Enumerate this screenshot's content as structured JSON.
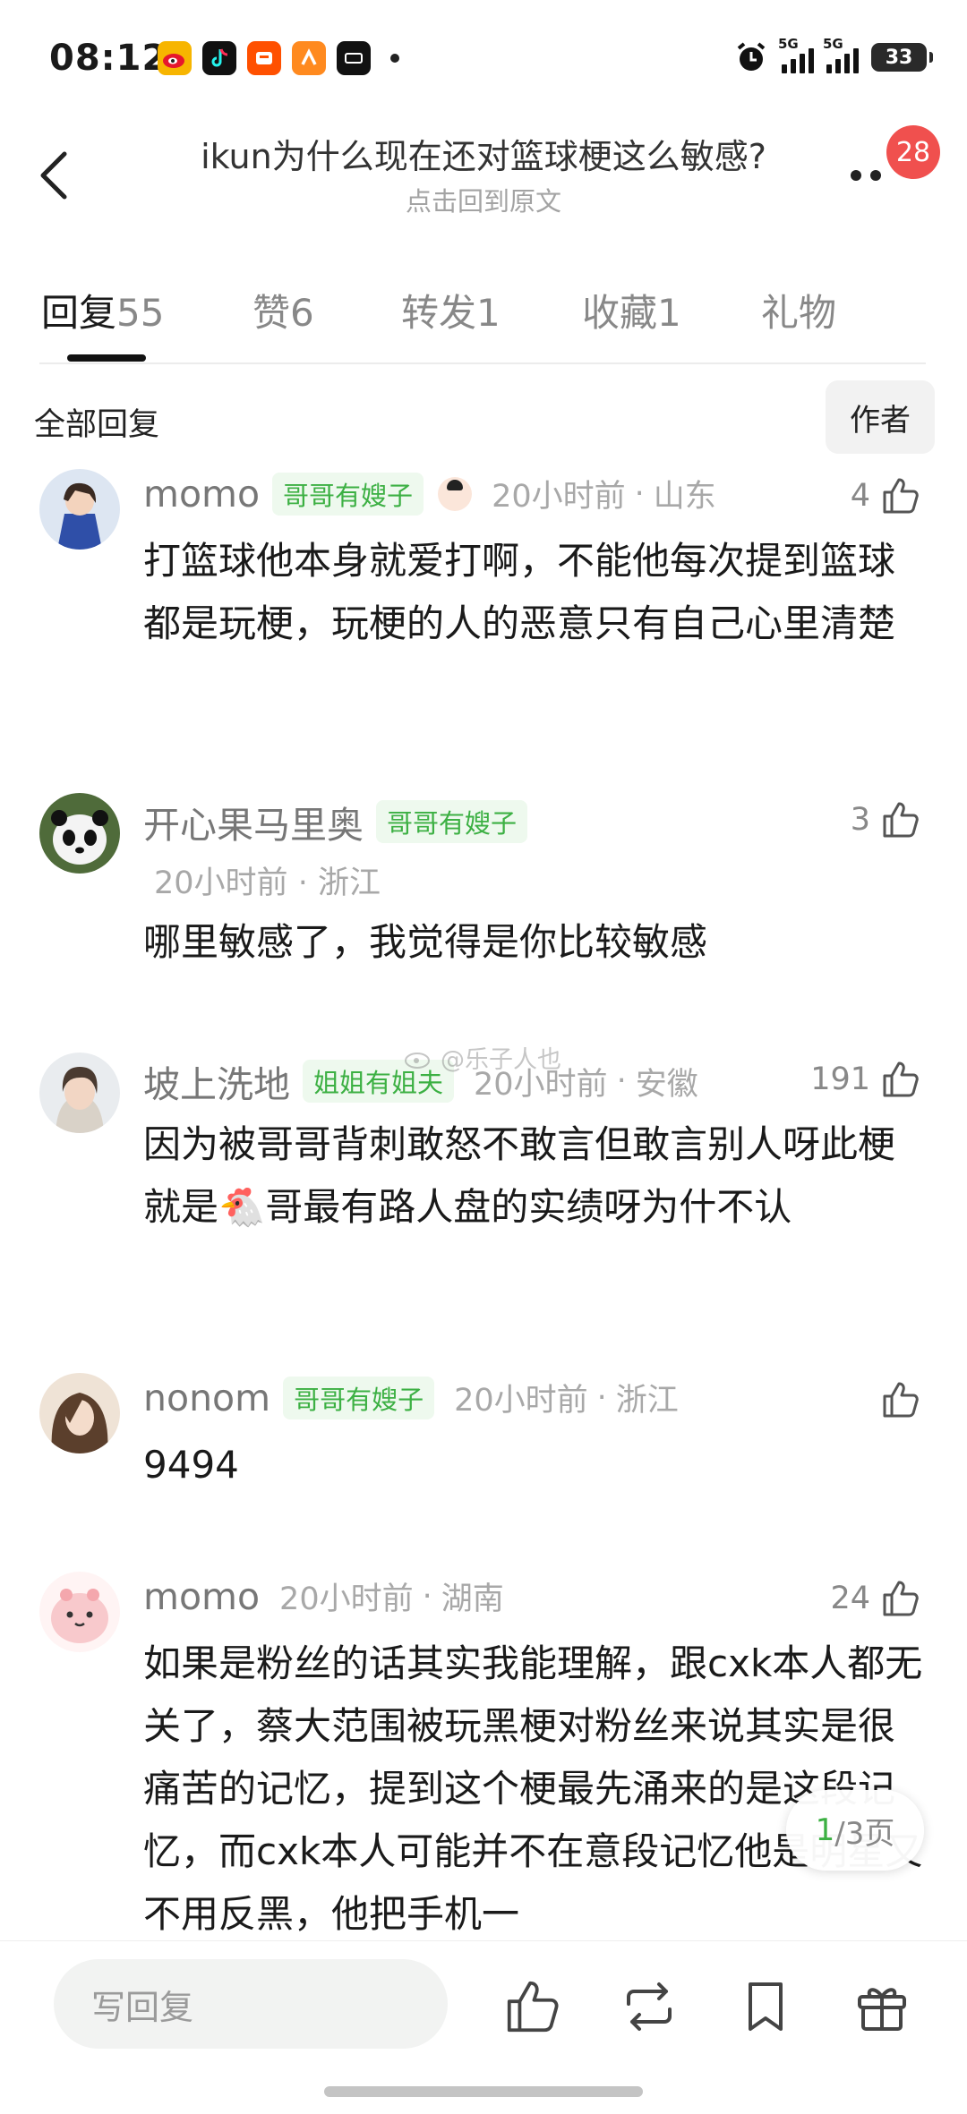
{
  "status_bar": {
    "time": "08:12",
    "apps": [
      "weibo-icon",
      "douyin-icon",
      "taobao-icon",
      "meituan-icon",
      "dewu-icon"
    ],
    "network_label": "5G",
    "battery": "33"
  },
  "header": {
    "title": "ikun为什么现在还对篮球梗这么敏感?",
    "subtitle": "点击回到原文",
    "notification_count": "28"
  },
  "tabs": [
    {
      "label": "回复",
      "count": "55"
    },
    {
      "label": "赞",
      "count": "6"
    },
    {
      "label": "转发",
      "count": "1"
    },
    {
      "label": "收藏",
      "count": "1"
    },
    {
      "label": "礼物",
      "count": ""
    }
  ],
  "filter": {
    "label": "全部回复",
    "author_button": "作者"
  },
  "comments": [
    {
      "name": "momo",
      "badge": "哥哥有嫂子",
      "time": "20小时前",
      "location": "山东",
      "likes": "4",
      "text": "打篮球他本身就爱打啊，不能他每次提到篮球都是玩梗，玩梗的人的恶意只有自己心里清楚"
    },
    {
      "name": "开心果马里奥",
      "badge": "哥哥有嫂子",
      "time": "20小时前",
      "location": "浙江",
      "likes": "3",
      "text": "哪里敏感了，我觉得是你比较敏感"
    },
    {
      "name": "坡上洗地",
      "badge": "姐姐有姐夫",
      "time": "20小时前",
      "location": "安徽",
      "likes": "191",
      "text": "因为被哥哥背刺敢怒不敢言但敢言别人呀此梗就是🐔哥最有路人盘的实绩呀为什不认"
    },
    {
      "name": "nonom",
      "badge": "哥哥有嫂子",
      "time": "20小时前",
      "location": "浙江",
      "likes": "",
      "text": "9494"
    },
    {
      "name": "momo",
      "badge": "",
      "time": "20小时前",
      "location": "湖南",
      "likes": "24",
      "text": "如果是粉丝的话其实我能理解，跟cxk本人都无关了，蔡大范围被玩黑梗对粉丝来说其实是很痛苦的记忆，提到这个梗最先涌来的是这段记忆，而cxk本人可能并不在意段记忆他是明星又不用反黑，他把手机一"
    }
  ],
  "pagination": {
    "current": "1",
    "total": "/3页"
  },
  "watermark": "@乐子人也",
  "bottom_bar": {
    "reply_placeholder": "写回复"
  },
  "colors": {
    "accent_green": "#3cb043",
    "badge_bg": "#eef9ee",
    "notification_red": "#f0504e"
  }
}
